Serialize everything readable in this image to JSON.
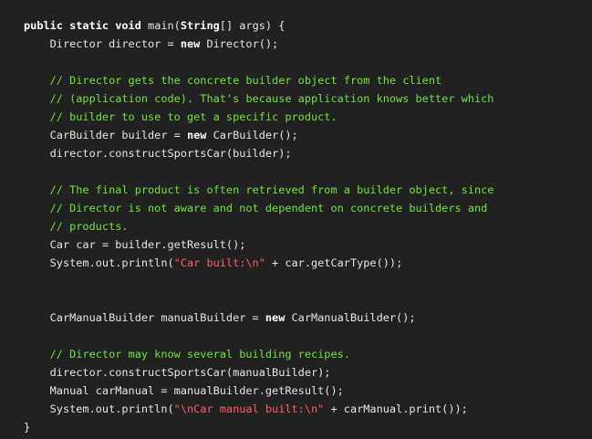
{
  "code": {
    "lines": [
      [
        {
          "t": "kw",
          "v": "public static void "
        },
        {
          "t": "plain",
          "v": "main("
        },
        {
          "t": "kw",
          "v": "String"
        },
        {
          "t": "plain",
          "v": "[] args) {"
        }
      ],
      [
        {
          "t": "plain",
          "v": "    Director director = "
        },
        {
          "t": "kw",
          "v": "new"
        },
        {
          "t": "plain",
          "v": " Director();"
        }
      ],
      [],
      [
        {
          "t": "comment",
          "v": "    // Director gets the concrete builder object from the client"
        }
      ],
      [
        {
          "t": "comment",
          "v": "    // (application code). That's because application knows better which"
        }
      ],
      [
        {
          "t": "comment",
          "v": "    // builder to use to get a specific product."
        }
      ],
      [
        {
          "t": "plain",
          "v": "    CarBuilder builder = "
        },
        {
          "t": "kw",
          "v": "new"
        },
        {
          "t": "plain",
          "v": " CarBuilder();"
        }
      ],
      [
        {
          "t": "plain",
          "v": "    director.constructSportsCar(builder);"
        }
      ],
      [],
      [
        {
          "t": "comment",
          "v": "    // The final product is often retrieved from a builder object, since"
        }
      ],
      [
        {
          "t": "comment",
          "v": "    // Director is not aware and not dependent on concrete builders and"
        }
      ],
      [
        {
          "t": "comment",
          "v": "    // products."
        }
      ],
      [
        {
          "t": "plain",
          "v": "    Car car = builder.getResult();"
        }
      ],
      [
        {
          "t": "plain",
          "v": "    System.out.println("
        },
        {
          "t": "string",
          "v": "\"Car built:\\n\""
        },
        {
          "t": "plain",
          "v": " + car.getCarType());"
        }
      ],
      [],
      [],
      [
        {
          "t": "plain",
          "v": "    CarManualBuilder manualBuilder = "
        },
        {
          "t": "kw",
          "v": "new"
        },
        {
          "t": "plain",
          "v": " CarManualBuilder();"
        }
      ],
      [],
      [
        {
          "t": "comment",
          "v": "    // Director may know several building recipes."
        }
      ],
      [
        {
          "t": "plain",
          "v": "    director.constructSportsCar(manualBuilder);"
        }
      ],
      [
        {
          "t": "plain",
          "v": "    Manual carManual = manualBuilder.getResult();"
        }
      ],
      [
        {
          "t": "plain",
          "v": "    System.out.println("
        },
        {
          "t": "string",
          "v": "\"\\nCar manual built:\\n\""
        },
        {
          "t": "plain",
          "v": " + carManual.print());"
        }
      ],
      [
        {
          "t": "plain",
          "v": "}"
        }
      ]
    ]
  },
  "colors": {
    "background": "#212121",
    "text": "#e6e6e6",
    "keyword": "#ffffff",
    "comment": "#73e23c",
    "string": "#ff5a6b"
  }
}
